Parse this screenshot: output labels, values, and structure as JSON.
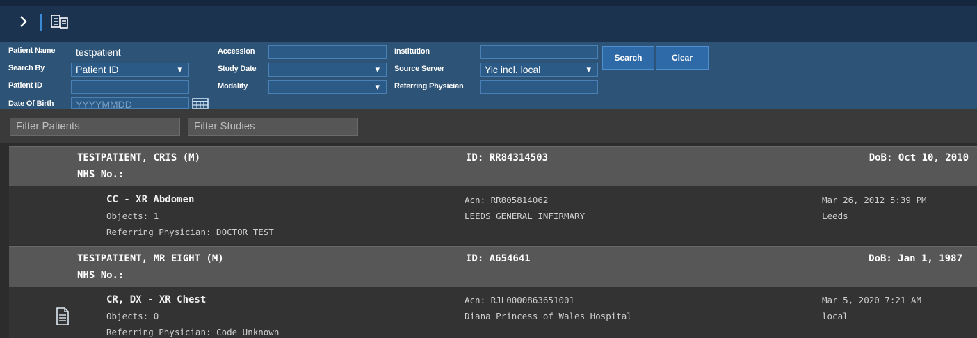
{
  "search": {
    "patient_name_label": "Patient Name",
    "patient_name_value": "testpatient",
    "search_by_label": "Search By",
    "search_by_value": "Patient ID",
    "patient_id_label": "Patient ID",
    "patient_id_value": "",
    "dob_label": "Date Of Birth",
    "dob_placeholder": "YYYYMMDD",
    "accession_label": "Accession",
    "accession_value": "",
    "study_date_label": "Study Date",
    "study_date_value": "",
    "modality_label": "Modality",
    "modality_value": "",
    "institution_label": "Institution",
    "institution_value": "",
    "source_server_label": "Source Server",
    "source_server_value": "Yic incl. local",
    "referring_label": "Referring Physician",
    "referring_value": "",
    "search_button": "Search",
    "clear_button": "Clear"
  },
  "filters": {
    "patients_placeholder": "Filter Patients",
    "studies_placeholder": "Filter Studies"
  },
  "patients": [
    {
      "name": "TESTPATIENT, CRIS (M)",
      "nhs": "NHS No.:",
      "id": "ID: RR84314503",
      "dob": "DoB: Oct 10, 2010",
      "study": {
        "title": "CC - XR Abdomen",
        "objects": "Objects: 1",
        "referring": "Referring Physician: DOCTOR TEST",
        "acn": "Acn: RR805814062",
        "institution": "LEEDS GENERAL INFIRMARY",
        "datetime": "Mar 26, 2012 5:39 PM",
        "source": "Leeds"
      }
    },
    {
      "name": "TESTPATIENT, MR EIGHT (M)",
      "nhs": "NHS No.:",
      "id": "ID: A654641",
      "dob": "DoB: Jan 1, 1987",
      "study": {
        "title": "CR, DX - XR Chest",
        "objects": "Objects: 0",
        "referring": "Referring Physician: Code Unknown",
        "acn": "Acn: RJL0000863651001",
        "institution": "Diana Princess of Wales Hospital",
        "datetime": "Mar 5, 2020 7:21 AM",
        "source": "local"
      }
    }
  ],
  "icons": {
    "expand": "chevron-right-icon",
    "reports": "document-list-icon",
    "calendar": "calendar-icon",
    "study_doc": "document-icon"
  },
  "colors": {
    "topbar": "#1c3350",
    "search_panel": "#2d5376",
    "patient_header": "#575757",
    "study_row": "#333333"
  }
}
